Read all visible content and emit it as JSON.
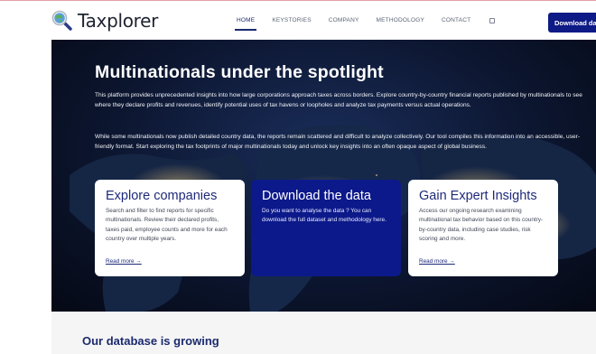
{
  "brand": {
    "name": "Taxplorer"
  },
  "nav": {
    "items": [
      {
        "label": "HOME",
        "active": true
      },
      {
        "label": "KEYSTORIES",
        "active": false
      },
      {
        "label": "COMPANY",
        "active": false
      },
      {
        "label": "METHODOLOGY",
        "active": false
      },
      {
        "label": "CONTACT",
        "active": false
      }
    ],
    "download_button": "Download data"
  },
  "hero": {
    "title": "Multinationals under the spotlight",
    "paragraph1": "This platform provides unprecedented insights into how large corporations approach taxes across borders. Explore country-by-country financial reports published by multinationals to see where they declare profits and revenues, identify potential uses of tax havens or loopholes and analyze tax payments versus actual operations.",
    "paragraph2": "While some multinationals now publish detailed country data, the reports remain scattered and difficult to analyze collectively. Our tool compiles this information into an accessible, user-friendly format. Start exploring the tax footprints of major multinationals today and unlock key insights into an often opaque aspect of global business."
  },
  "cards": [
    {
      "title": "Explore companies",
      "text": "Search and filter to find reports for specific multinationals. Review their declared profits, taxes paid, employee counts and more for each country over multiple years.",
      "link": "Read more →"
    },
    {
      "title": "Download the data",
      "text": "Do you want to analyse the data ? You can download the full dataset and methodology here.",
      "link": ""
    },
    {
      "title": "Gain Expert Insights",
      "text": "Access our ongoing research examining multinational tax behavior based on this country-by-country data, including case studies, risk scoring and more.",
      "link": "Read more →"
    }
  ],
  "section": {
    "title": "Our database is growing"
  },
  "colors": {
    "brand_blue": "#0e1a85",
    "heading_blue": "#1e2a7a",
    "hero_dark": "#0c1630",
    "section_bg": "#f5f5f5"
  },
  "icons": {
    "logo": "magnifier-globe-icon",
    "search": "search-icon"
  }
}
